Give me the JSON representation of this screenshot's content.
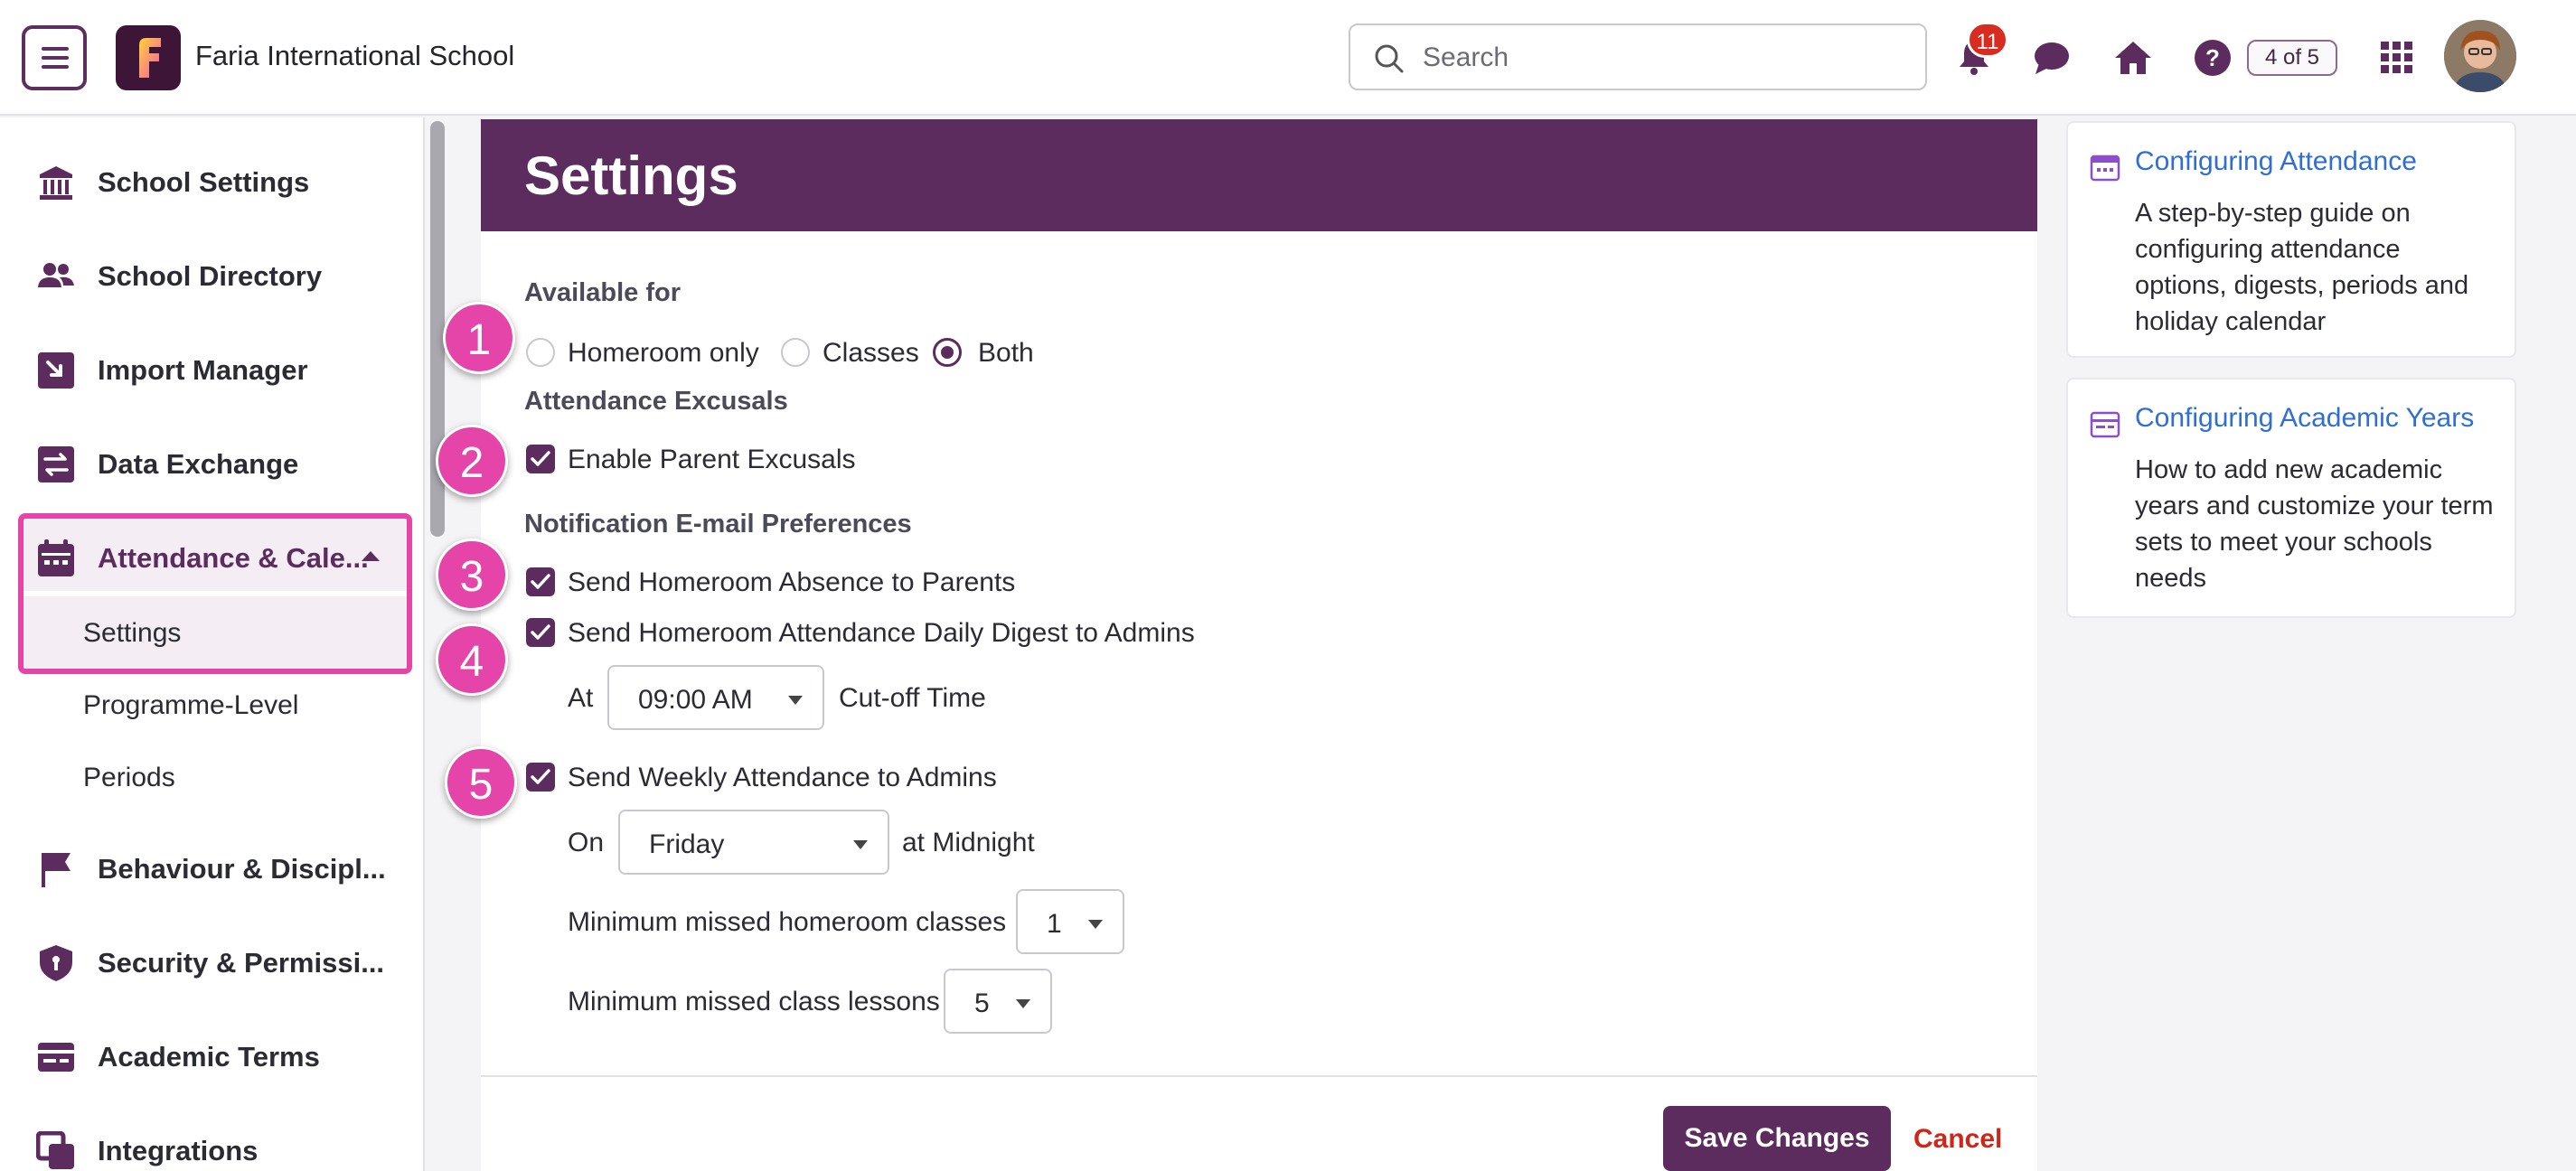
{
  "topbar": {
    "school_name": "Faria International School",
    "search_placeholder": "Search",
    "notification_count": "11",
    "pager": "4 of 5"
  },
  "sidebar": {
    "items": [
      {
        "label": "School Settings"
      },
      {
        "label": "School Directory"
      },
      {
        "label": "Import Manager"
      },
      {
        "label": "Data Exchange"
      },
      {
        "label": "Attendance & Cale..."
      },
      {
        "label": "Behaviour & Discipl..."
      },
      {
        "label": "Security & Permissi..."
      },
      {
        "label": "Academic Terms"
      },
      {
        "label": "Integrations"
      }
    ],
    "subitems": [
      "Settings",
      "Programme-Level",
      "Periods"
    ]
  },
  "settings": {
    "title": "Settings",
    "available_for": {
      "label": "Available for",
      "options": [
        "Homeroom only",
        "Classes",
        "Both"
      ],
      "selected": "Both"
    },
    "excusals": {
      "label": "Attendance Excusals",
      "enable_parent": "Enable Parent Excusals"
    },
    "notifications": {
      "label": "Notification E-mail Preferences",
      "absence_to_parents": "Send Homeroom Absence to Parents",
      "daily_digest": "Send Homeroom Attendance Daily Digest to Admins",
      "at_label": "At",
      "time_value": "09:00 AM",
      "cutoff_label": "Cut-off Time",
      "weekly": "Send Weekly Attendance to Admins",
      "on_label": "On",
      "day_value": "Friday",
      "midnight_label": "at Midnight",
      "min_homeroom_label": "Minimum missed homeroom classes",
      "min_homeroom_value": "1",
      "min_lessons_label": "Minimum missed class lessons",
      "min_lessons_value": "5"
    },
    "save_label": "Save Changes",
    "cancel_label": "Cancel"
  },
  "steps": [
    "1",
    "2",
    "3",
    "4",
    "5"
  ],
  "help": [
    {
      "title": "Configuring Attendance",
      "description": "A step-by-step guide on configuring attendance options, digests, periods and holiday calendar"
    },
    {
      "title": "Configuring Academic Years",
      "description": "How to add new academic years and customize your term sets to meet your schools needs"
    }
  ],
  "colors": {
    "brand": "#5b2c5d",
    "highlight": "#e545a8",
    "link": "#2f6fd1",
    "danger": "#d0261a"
  }
}
